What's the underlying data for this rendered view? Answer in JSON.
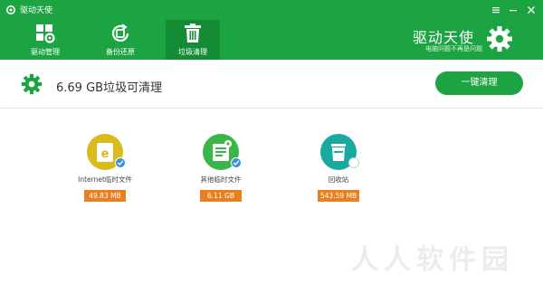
{
  "window": {
    "title": "驱动天使"
  },
  "colors": {
    "brand_green": "#1ba441",
    "active_tab": "#148c36",
    "size_badge": "#e8801f",
    "internet_icon": "#d9bc1c",
    "other_icon": "#39b54a",
    "recycle_icon": "#1aa9a0"
  },
  "toolbar": {
    "items": [
      {
        "label": "驱动管理",
        "icon": "grid-gear-icon"
      },
      {
        "label": "备份还原",
        "icon": "backup-restore-icon"
      },
      {
        "label": "垃圾清理",
        "icon": "trash-icon",
        "active": true
      }
    ],
    "brand_name": "驱动天使",
    "brand_slogan": "电脑问题不再是问题"
  },
  "summary": {
    "text": "6.69 GB垃圾可清理",
    "clean_button": "一键清理"
  },
  "items": [
    {
      "label": "Internet临时文件",
      "size": "49.83 MB",
      "icon": "ie-icon",
      "checked": true
    },
    {
      "label": "其他临时文件",
      "size": "6.11 GB",
      "icon": "file-icon",
      "checked": true
    },
    {
      "label": "回收站",
      "size": "543.59 MB",
      "icon": "recycle-bin-icon",
      "checked": false
    }
  ],
  "watermark": "人人软件园"
}
